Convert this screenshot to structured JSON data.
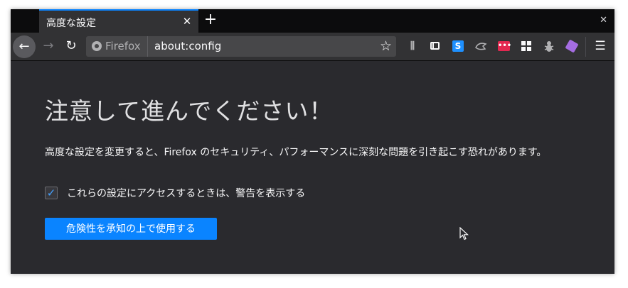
{
  "tab": {
    "title": "高度な設定",
    "close": "✕"
  },
  "tabstrip": {
    "newtab": "+",
    "window_close": "✕"
  },
  "nav": {
    "back": "←",
    "forward": "→",
    "reload": "↻",
    "identity_label": "Firefox",
    "url": "about:config",
    "bookmark_star": "☆",
    "library": "⫼",
    "menu": "☰"
  },
  "extensions": {
    "s_label": "S",
    "red_label": "•••"
  },
  "page": {
    "title": "注意して進んでください！",
    "description": "高度な設定を変更すると、Firefox のセキュリティ、パフォーマンスに深刻な問題を引き起こす恐れがあります。",
    "checkbox_label": "これらの設定にアクセスするときは、警告を表示する",
    "checkbox_checked": true,
    "checkmark": "✓",
    "accept_button": "危険性を承知の上で使用する"
  },
  "colors": {
    "accent": "#0a84ff",
    "background": "#2a2a2e",
    "toolbar": "#323234"
  }
}
